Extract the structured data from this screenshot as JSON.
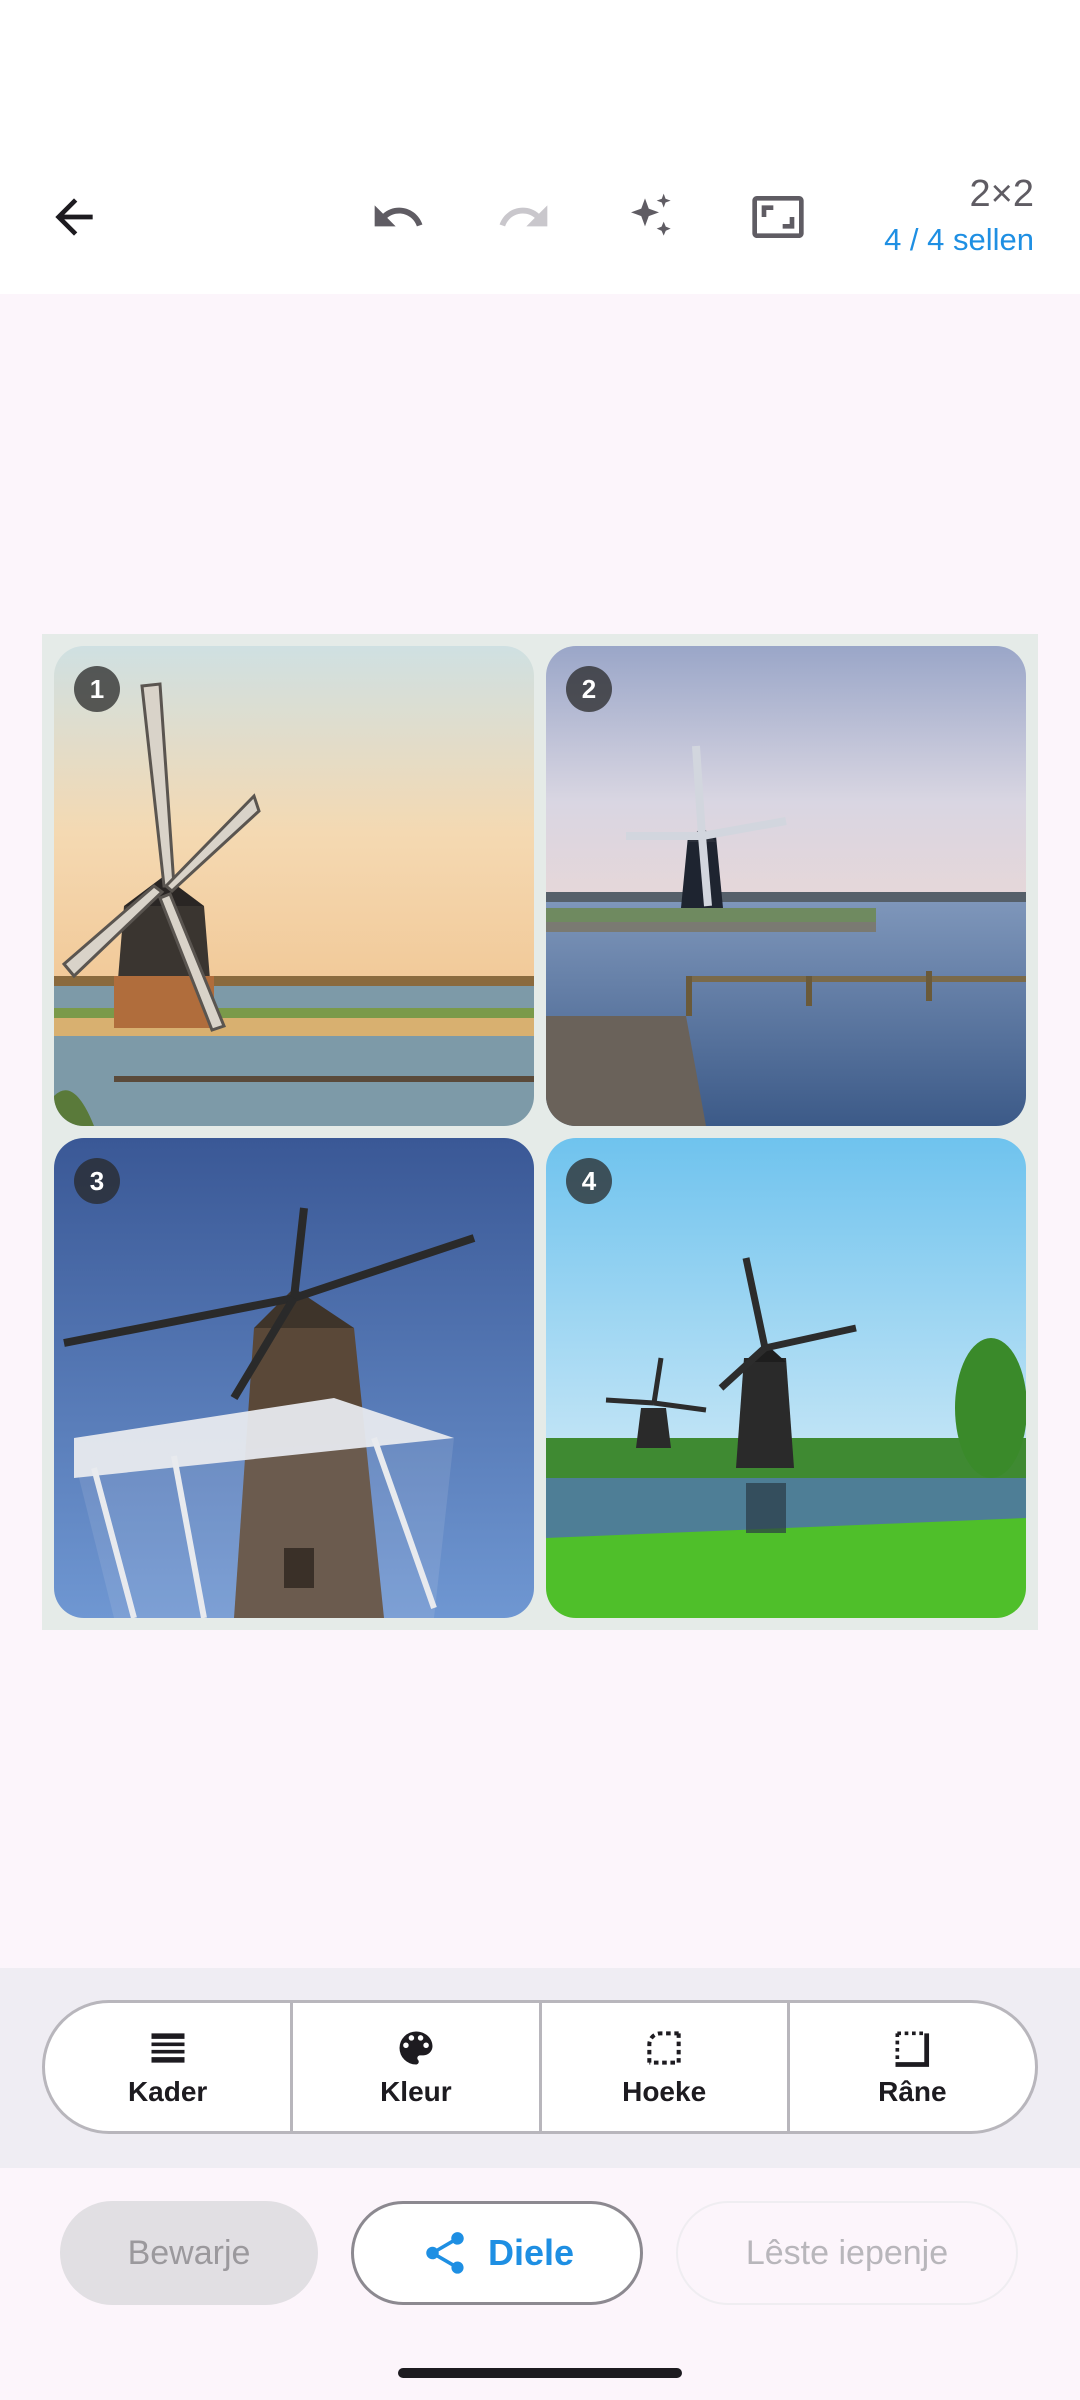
{
  "toolbar": {
    "back_icon": "arrow-left-icon",
    "undo_icon": "undo-icon",
    "redo_icon": "redo-icon",
    "magic_icon": "sparkles-icon",
    "aspect_icon": "aspect-ratio-icon",
    "grid_size": "2×2",
    "cell_count": "4 / 4 sellen"
  },
  "collage": {
    "tiles": [
      {
        "number": "1",
        "subject": "windmill-golden-hour"
      },
      {
        "number": "2",
        "subject": "windmill-lake-dusk"
      },
      {
        "number": "3",
        "subject": "windmill-blue-sky-lowangle"
      },
      {
        "number": "4",
        "subject": "windmills-canal-green-reeds"
      }
    ],
    "background_color": "#e5ebe8"
  },
  "tools": [
    {
      "label": "Kader",
      "icon": "layout-lines-icon"
    },
    {
      "label": "Kleur",
      "icon": "palette-icon"
    },
    {
      "label": "Hoeke",
      "icon": "corner-icon"
    },
    {
      "label": "Râne",
      "icon": "border-icon"
    }
  ],
  "actions": {
    "save_label": "Bewarje",
    "share_label": "Diele",
    "last_open_label": "Lêste iepenje"
  },
  "colors": {
    "accent": "#1e8fe3",
    "page_background": "#fcf5fb"
  }
}
